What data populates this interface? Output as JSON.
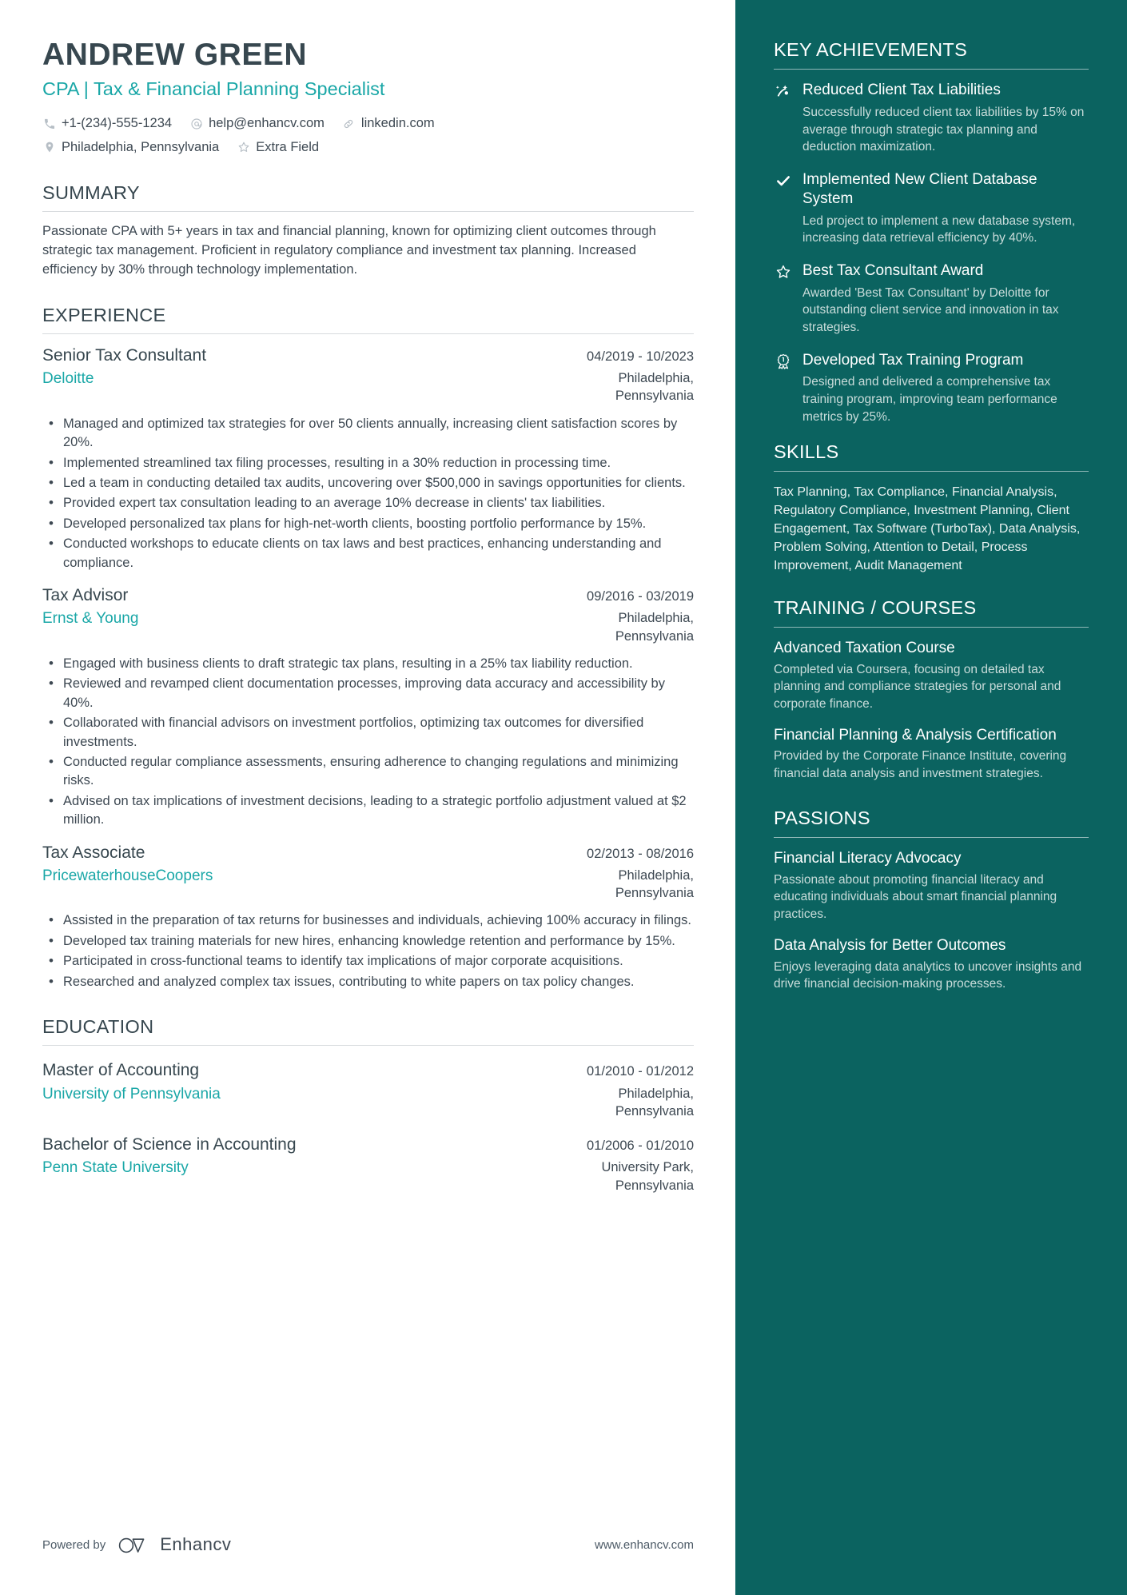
{
  "header": {
    "name": "ANDREW GREEN",
    "headline": "CPA | Tax & Financial Planning Specialist",
    "contacts_row1": [
      {
        "icon": "phone-icon",
        "text": "+1-(234)-555-1234"
      },
      {
        "icon": "email-icon",
        "text": "help@enhancv.com"
      },
      {
        "icon": "link-icon",
        "text": "linkedin.com"
      }
    ],
    "contacts_row2": [
      {
        "icon": "location-icon",
        "text": "Philadelphia, Pennsylvania"
      },
      {
        "icon": "star-icon",
        "text": "Extra Field"
      }
    ]
  },
  "summary": {
    "title": "SUMMARY",
    "text": "Passionate CPA with 5+ years in tax and financial planning, known for optimizing client outcomes through strategic tax management. Proficient in regulatory compliance and investment tax planning. Increased efficiency by 30% through technology implementation."
  },
  "experience": {
    "title": "EXPERIENCE",
    "entries": [
      {
        "role": "Senior Tax Consultant",
        "date": "04/2019 - 10/2023",
        "company": "Deloitte",
        "location": "Philadelphia, Pennsylvania",
        "bullets": [
          "Managed and optimized tax strategies for over 50 clients annually, increasing client satisfaction scores by 20%.",
          "Implemented streamlined tax filing processes, resulting in a 30% reduction in processing time.",
          "Led a team in conducting detailed tax audits, uncovering over $500,000 in savings opportunities for clients.",
          "Provided expert tax consultation leading to an average 10% decrease in clients' tax liabilities.",
          "Developed personalized tax plans for high-net-worth clients, boosting portfolio performance by 15%.",
          "Conducted workshops to educate clients on tax laws and best practices, enhancing understanding and compliance."
        ]
      },
      {
        "role": "Tax Advisor",
        "date": "09/2016 - 03/2019",
        "company": "Ernst & Young",
        "location": "Philadelphia, Pennsylvania",
        "bullets": [
          "Engaged with business clients to draft strategic tax plans, resulting in a 25% tax liability reduction.",
          "Reviewed and revamped client documentation processes, improving data accuracy and accessibility by 40%.",
          "Collaborated with financial advisors on investment portfolios, optimizing tax outcomes for diversified investments.",
          "Conducted regular compliance assessments, ensuring adherence to changing regulations and minimizing risks.",
          "Advised on tax implications of investment decisions, leading to a strategic portfolio adjustment valued at $2 million."
        ]
      },
      {
        "role": "Tax Associate",
        "date": "02/2013 - 08/2016",
        "company": "PricewaterhouseCoopers",
        "location": "Philadelphia, Pennsylvania",
        "bullets": [
          "Assisted in the preparation of tax returns for businesses and individuals, achieving 100% accuracy in filings.",
          "Developed tax training materials for new hires, enhancing knowledge retention and performance by 15%.",
          "Participated in cross-functional teams to identify tax implications of major corporate acquisitions.",
          "Researched and analyzed complex tax issues, contributing to white papers on tax policy changes."
        ]
      }
    ]
  },
  "education": {
    "title": "EDUCATION",
    "entries": [
      {
        "degree": "Master of Accounting",
        "date": "01/2010 - 01/2012",
        "school": "University of Pennsylvania",
        "location": "Philadelphia, Pennsylvania"
      },
      {
        "degree": "Bachelor of Science in Accounting",
        "date": "01/2006 - 01/2010",
        "school": "Penn State University",
        "location": "University Park, Pennsylvania"
      }
    ]
  },
  "footer": {
    "powered_by": "Powered by",
    "brand": "Enhancv",
    "url": "www.enhancv.com"
  },
  "sidebar": {
    "achievements": {
      "title": "KEY ACHIEVEMENTS",
      "items": [
        {
          "icon": "trend-arrow-icon",
          "title": "Reduced Client Tax Liabilities",
          "desc": "Successfully reduced client tax liabilities by 15% on average through strategic tax planning and deduction maximization."
        },
        {
          "icon": "check-icon",
          "title": "Implemented New Client Database System",
          "desc": "Led project to implement a new database system, increasing data retrieval efficiency by 40%."
        },
        {
          "icon": "star-icon",
          "title": "Best Tax Consultant Award",
          "desc": "Awarded 'Best Tax Consultant' by Deloitte for outstanding client service and innovation in tax strategies."
        },
        {
          "icon": "medal-icon",
          "title": "Developed Tax Training Program",
          "desc": "Designed and delivered a comprehensive tax training program, improving team performance metrics by 25%."
        }
      ]
    },
    "skills": {
      "title": "SKILLS",
      "text": "Tax Planning, Tax Compliance, Financial Analysis, Regulatory Compliance, Investment Planning, Client Engagement, Tax Software (TurboTax), Data Analysis, Problem Solving, Attention to Detail, Process Improvement, Audit Management"
    },
    "training": {
      "title": "TRAINING / COURSES",
      "items": [
        {
          "title": "Advanced Taxation Course",
          "desc": "Completed via Coursera, focusing on detailed tax planning and compliance strategies for personal and corporate finance."
        },
        {
          "title": "Financial Planning & Analysis Certification",
          "desc": "Provided by the Corporate Finance Institute, covering financial data analysis and investment strategies."
        }
      ]
    },
    "passions": {
      "title": "PASSIONS",
      "items": [
        {
          "title": "Financial Literacy Advocacy",
          "desc": "Passionate about promoting financial literacy and educating individuals about smart financial planning practices."
        },
        {
          "title": "Data Analysis for Better Outcomes",
          "desc": "Enjoys leveraging data analytics to uncover insights and drive financial decision-making processes."
        }
      ]
    }
  },
  "colors": {
    "accent_teal": "#1aa7a7",
    "sidebar_bg": "#0b6360",
    "heading": "#37474f",
    "body_text": "#3d4852"
  }
}
